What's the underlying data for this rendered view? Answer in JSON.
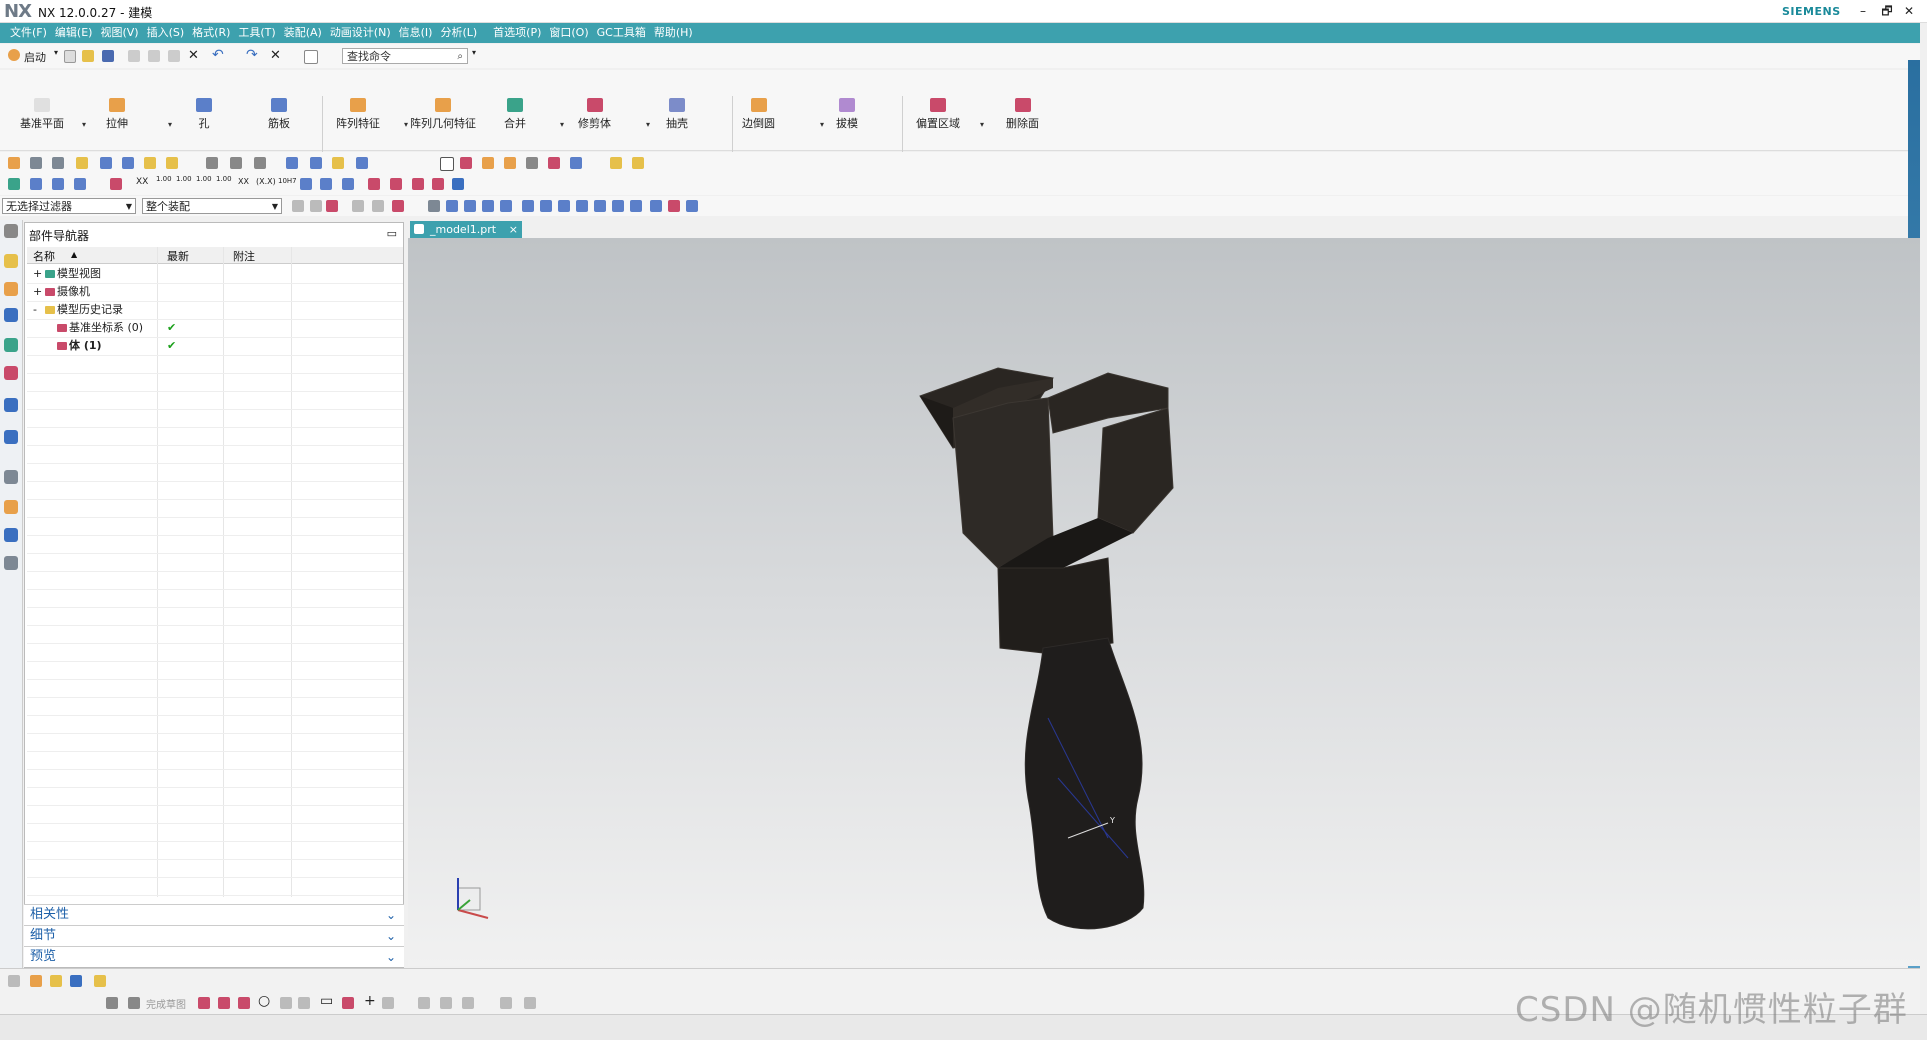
{
  "app": {
    "logo": "NX",
    "title": "NX 12.0.0.27 - 建模",
    "brand": "SIEMENS"
  },
  "window_controls": {
    "minimize": "–",
    "restore": "🗗",
    "close": "✕"
  },
  "menubar": {
    "items": [
      "文件(F)",
      "编辑(E)",
      "视图(V)",
      "插入(S)",
      "格式(R)",
      "工具(T)",
      "装配(A)",
      "动画设计(N)",
      "信息(I)",
      "分析(L)",
      "首选项(P)",
      "窗口(O)",
      "GC工具箱",
      "帮助(H)"
    ]
  },
  "quick_access": {
    "start_label": "启动",
    "search_placeholder": "查找命令"
  },
  "ribbon": {
    "buttons": [
      {
        "label": "基准平面",
        "icon": "datum-plane-icon",
        "color": "#e0e0e0"
      },
      {
        "label": "拉伸",
        "icon": "extrude-icon",
        "color": "#e8a04a"
      },
      {
        "label": "孔",
        "icon": "hole-icon",
        "color": "#5b7fc9"
      },
      {
        "label": "筋板",
        "icon": "rib-icon",
        "color": "#5b7fc9"
      },
      {
        "label": "阵列特征",
        "icon": "pattern-feature-icon",
        "color": "#e8a04a"
      },
      {
        "label": "阵列几何特征",
        "icon": "pattern-geometry-icon",
        "color": "#e8a04a"
      },
      {
        "label": "合并",
        "icon": "unite-icon",
        "color": "#3aa38a"
      },
      {
        "label": "修剪体",
        "icon": "trim-body-icon",
        "color": "#c94a6a"
      },
      {
        "label": "抽壳",
        "icon": "shell-icon",
        "color": "#7c8cc9"
      },
      {
        "label": "边倒圆",
        "icon": "edge-blend-icon",
        "color": "#e8a04a"
      },
      {
        "label": "拔模",
        "icon": "draft-icon",
        "color": "#b08ad0"
      },
      {
        "label": "偏置区域",
        "icon": "offset-region-icon",
        "color": "#c94a6a"
      },
      {
        "label": "删除面",
        "icon": "delete-face-icon",
        "color": "#c94a6a"
      }
    ]
  },
  "filter": {
    "selection_filter": "无选择过滤器",
    "scope": "整个装配"
  },
  "navigator": {
    "title": "部件导航器",
    "columns": {
      "name": "名称",
      "latest": "最新",
      "note": "附注"
    },
    "rows": [
      {
        "label": "模型视图",
        "expander": "+",
        "latest": ""
      },
      {
        "label": "摄像机",
        "expander": "+",
        "latest": ""
      },
      {
        "label": "模型历史记录",
        "expander": "-",
        "latest": ""
      },
      {
        "label": "基准坐标系 (0)",
        "expander": "",
        "latest": "✔"
      },
      {
        "label": "体 (1)",
        "expander": "",
        "latest": "✔"
      }
    ],
    "sections": [
      "相关性",
      "细节",
      "预览"
    ]
  },
  "graphics": {
    "tab_label": "_model1.prt",
    "tab_close": "×"
  },
  "watermark": "CSDN @随机惯性粒子群",
  "sketch_toolbar": {
    "finish_label": "完成草图"
  }
}
